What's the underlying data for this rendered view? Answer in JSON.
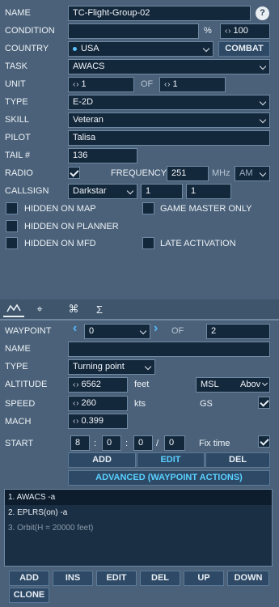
{
  "group": {
    "name_label": "NAME",
    "name_value": "TC-Flight-Group-02",
    "help_icon": "?",
    "condition_label": "CONDITION",
    "condition_value": "",
    "percent_sign": "%",
    "probability": "100",
    "country_label": "COUNTRY",
    "country_value": "USA",
    "combat_label": "COMBAT",
    "task_label": "TASK",
    "task_value": "AWACS",
    "unit_label": "UNIT",
    "unit_value": "1",
    "of_label": "OF",
    "unit_total": "1",
    "type_label": "TYPE",
    "type_value": "E-2D",
    "skill_label": "SKILL",
    "skill_value": "Veteran",
    "pilot_label": "PILOT",
    "pilot_value": "Talisa",
    "tail_label": "TAIL #",
    "tail_value": "136",
    "radio_label": "RADIO",
    "radio_checked": true,
    "frequency_label": "FREQUENCY",
    "frequency_value": "251",
    "mhz_label": "MHz",
    "modulation": "AM",
    "callsign_label": "CALLSIGN",
    "callsign_value": "Darkstar",
    "callsign_num1": "1",
    "callsign_num2": "1",
    "hidden_on_map": "HIDDEN ON MAP",
    "game_master_only": "GAME MASTER ONLY",
    "hidden_on_planner": "HIDDEN ON PLANNER",
    "hidden_on_mfd": "HIDDEN ON MFD",
    "late_activation": "LATE ACTIVATION"
  },
  "tabs": [
    {
      "name": "route-icon",
      "glyph": "∧"
    },
    {
      "name": "target-icon",
      "glyph": "⌖"
    },
    {
      "name": "command-icon",
      "glyph": "⌘"
    },
    {
      "name": "sigma-icon",
      "glyph": "Σ"
    }
  ],
  "waypoint": {
    "waypoint_label": "WAYPOINT",
    "waypoint_value": "0",
    "of_label": "OF",
    "waypoint_total": "2",
    "name_label": "NAME",
    "name_value": "",
    "type_label": "TYPE",
    "type_value": "Turning point",
    "altitude_label": "ALTITUDE",
    "altitude_value": "6562",
    "altitude_unit": "feet",
    "altitude_ref": "MSL",
    "above_label": "Abov",
    "speed_label": "SPEED",
    "speed_value": "260",
    "speed_unit": "kts",
    "gs_label": "GS",
    "gs_checked": true,
    "mach_label": "MACH",
    "mach_value": "0.399",
    "start_label": "START",
    "start_d": "8",
    "start_h": "0",
    "start_m": "0",
    "start_s": "0",
    "sep1": ":",
    "sep2": ":",
    "sep3": "/",
    "fix_time_label": "Fix time",
    "fix_time_checked": true,
    "add": "ADD",
    "edit": "EDIT",
    "del": "DEL",
    "advanced": "ADVANCED (WAYPOINT ACTIONS)"
  },
  "actions": [
    {
      "text": "1. AWACS -a"
    },
    {
      "text": "2. EPLRS(on)  -a"
    },
    {
      "text": "3. Orbit(H = 20000 feet)"
    }
  ],
  "bottom_buttons": {
    "add": "ADD",
    "ins": "INS",
    "edit": "EDIT",
    "del": "DEL",
    "up": "UP",
    "down": "DOWN",
    "clone": "CLONE"
  },
  "colors": {
    "panel": "#4a6179",
    "field": "#14283c",
    "button": "#2d4966",
    "active": "#5ad0ff"
  }
}
